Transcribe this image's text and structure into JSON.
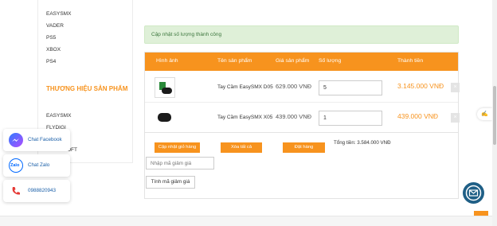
{
  "sidebar": {
    "top_items": [
      "EASYSMX",
      "VADER",
      "PS5",
      "XBOX",
      "PS4"
    ],
    "brand_title": "THƯƠNG HIỆU SẢN PHẨM",
    "brand_items": [
      "EASYSMX",
      "FLYDIGI",
      "MICROSOFT"
    ]
  },
  "alert": {
    "message": "Cập nhật số lượng thành công"
  },
  "cart": {
    "headers": [
      "Hình ảnh",
      "Tên sản phẩm",
      "Giá sản phẩm",
      "Số lượng",
      "Thành tiền"
    ],
    "rows": [
      {
        "name": "Tay Cầm EasySMX D05",
        "price": "629.000 VNĐ",
        "quantity": "5",
        "total": "3.145.000 VNĐ",
        "delete_icon": "×"
      },
      {
        "name": "Tay Cầm EasySMX X05",
        "price": "439.000 VNĐ",
        "quantity": "1",
        "total": "439.000 VNĐ",
        "delete_icon": "×"
      }
    ],
    "update_label": "Cập nhật giỏ hàng",
    "clear_label": "Xóa tất cả",
    "order_label": "Đặt hàng",
    "grand_total": "Tổng tiền: 3.584.000 VNĐ"
  },
  "coupon": {
    "placeholder": "Nhập mã giảm giá",
    "button_label": "Tính mã giảm giá"
  },
  "chat": {
    "facebook_label": "Chat Facebook",
    "zalo_label": "Chat Zalo",
    "zalo_icon_text": "Zalo",
    "phone_label": "0988820943"
  },
  "colors": {
    "accent": "#f7931e",
    "success_bg": "#dff0d8",
    "success_text": "#3c763d",
    "link_blue": "#1a5fa8"
  }
}
